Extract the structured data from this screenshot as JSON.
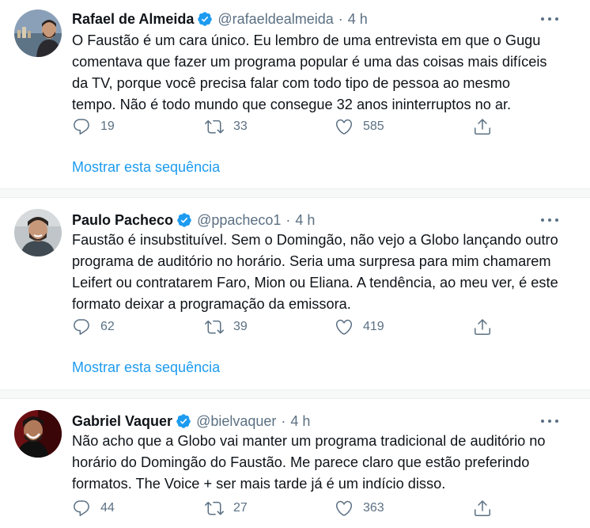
{
  "tweets": [
    {
      "name": "Rafael de Almeida",
      "handle": "@rafaeldealmeida",
      "dot": "·",
      "time": "4 h",
      "lines": [
        "O Faustão é um cara único. Eu lembro de uma entrevista em que o Gugu",
        "comentava que fazer um programa popular é uma das coisas mais difíceis",
        "da TV, porque você precisa falar com todo tipo de pessoa ao mesmo",
        "tempo. Não é todo mundo que consegue 32 anos ininterruptos no ar."
      ],
      "replies": "19",
      "retweets": "33",
      "likes": "585",
      "show_thread": "Mostrar esta sequência"
    },
    {
      "name": "Paulo Pacheco",
      "handle": "@ppacheco1",
      "dot": "·",
      "time": "4 h",
      "lines": [
        "Faustão é insubstituível. Sem o Domingão, não vejo a Globo lançando outro",
        "programa de auditório no horário. Seria uma surpresa para mim chamarem",
        "Leifert ou contratarem Faro, Mion ou Eliana. A tendência, ao meu ver, é este",
        "formato deixar a programação da emissora."
      ],
      "replies": "62",
      "retweets": "39",
      "likes": "419",
      "show_thread": "Mostrar esta sequência"
    },
    {
      "name": "Gabriel Vaquer",
      "handle": "@bielvaquer",
      "dot": "·",
      "time": "4 h",
      "lines": [
        "Não acho que a Globo vai manter um programa tradicional de auditório no",
        "horário do Domingão do Faustão. Me parece claro que estão preferindo",
        "formatos. The Voice + ser mais tarde já é um indício disso."
      ],
      "replies": "44",
      "retweets": "27",
      "likes": "363"
    }
  ],
  "colors": {
    "accent": "#1d9bf0",
    "muted": "#5b7083",
    "text": "#0f1419"
  },
  "icons": [
    "verified-badge-icon",
    "more-icon",
    "reply-icon",
    "retweet-icon",
    "like-icon",
    "share-icon"
  ]
}
